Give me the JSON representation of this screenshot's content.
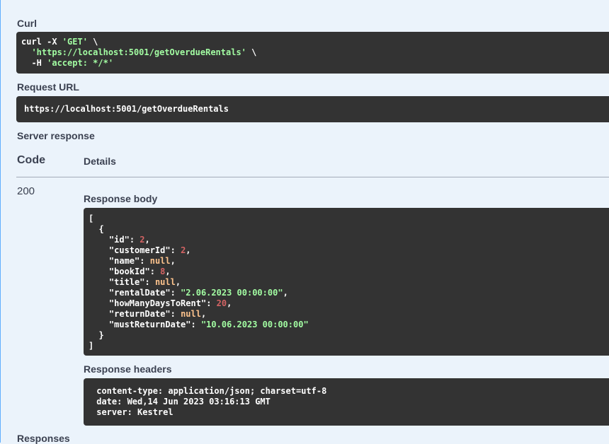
{
  "curl": {
    "label": "Curl",
    "line1_cmd": "curl -X ",
    "line1_method": "'GET'",
    "line1_tail": " \\",
    "line2_indent": "  ",
    "line2_url": "'https://localhost:5001/getOverdueRentals'",
    "line2_tail": " \\",
    "line3_flag": "  -H ",
    "line3_header": "'accept: */*'"
  },
  "request_url": {
    "label": "Request URL",
    "value": "https://localhost:5001/getOverdueRentals"
  },
  "server_response": {
    "label": "Server response",
    "code_header": "Code",
    "details_header": "Details",
    "status_code": "200",
    "response_body": {
      "label": "Response body",
      "open_bracket": "[",
      "open_brace": "  {",
      "close_brace": "  }",
      "close_bracket": "]",
      "fields": [
        {
          "key": "\"id\"",
          "value": "2",
          "kind": "num",
          "comma": ","
        },
        {
          "key": "\"customerId\"",
          "value": "2",
          "kind": "num",
          "comma": ","
        },
        {
          "key": "\"name\"",
          "value": "null",
          "kind": "lit",
          "comma": ","
        },
        {
          "key": "\"bookId\"",
          "value": "8",
          "kind": "num",
          "comma": ","
        },
        {
          "key": "\"title\"",
          "value": "null",
          "kind": "lit",
          "comma": ","
        },
        {
          "key": "\"rentalDate\"",
          "value": "\"2.06.2023 00:00:00\"",
          "kind": "str",
          "comma": ","
        },
        {
          "key": "\"howManyDaysToRent\"",
          "value": "20",
          "kind": "num",
          "comma": ","
        },
        {
          "key": "\"returnDate\"",
          "value": "null",
          "kind": "lit",
          "comma": ","
        },
        {
          "key": "\"mustReturnDate\"",
          "value": "\"10.06.2023 00:00:00\"",
          "kind": "str",
          "comma": ""
        }
      ]
    },
    "response_headers": {
      "label": "Response headers",
      "lines": [
        " content-type: application/json; charset=utf-8 ",
        " date: Wed,14 Jun 2023 03:16:13 GMT ",
        " server: Kestrel "
      ]
    }
  },
  "responses": {
    "label": "Responses"
  },
  "colors": {
    "background": "#ebf3fb",
    "code_bg": "#333333",
    "string": "#a2fca2",
    "number": "#d36363",
    "literal": "#fcc28c",
    "accent": "#61affe"
  }
}
